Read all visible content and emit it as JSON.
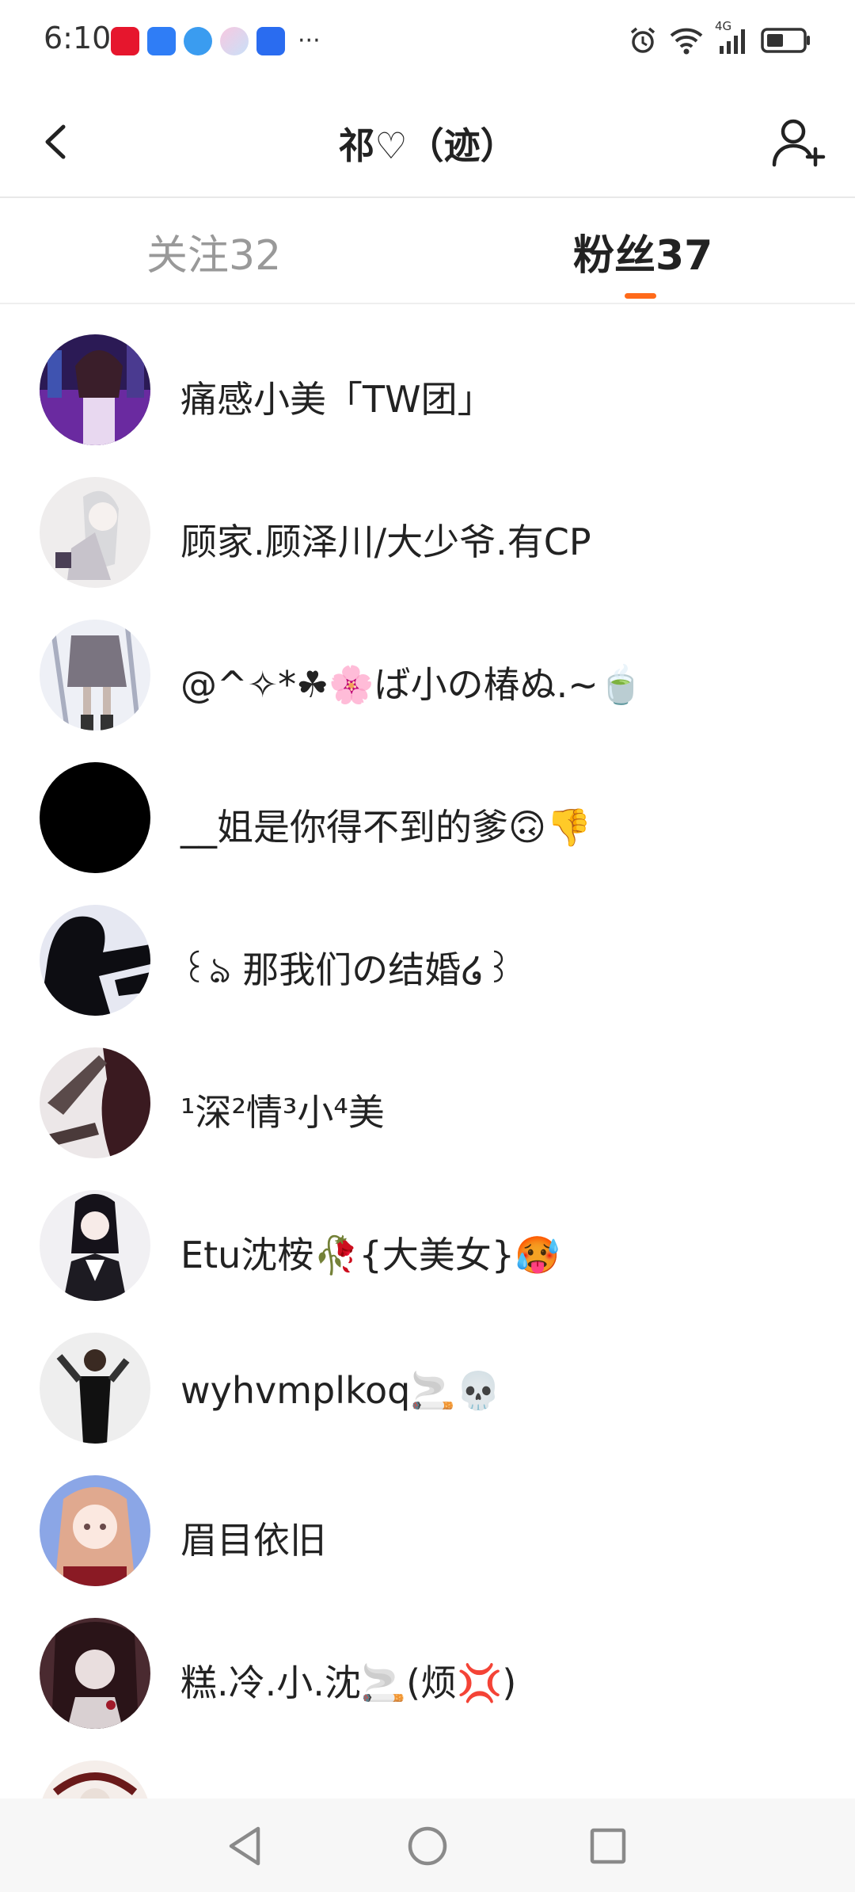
{
  "status_bar": {
    "time": "6:10",
    "more_notifications": "···",
    "network_label": "4G",
    "notification_icons": [
      "weibo-icon",
      "lightbulb-icon",
      "browser-icon",
      "pastel-app-icon",
      "lightning-app-icon"
    ],
    "system_icons": [
      "alarm-icon",
      "wifi-icon",
      "signal-icon",
      "battery-icon"
    ]
  },
  "header": {
    "title": "祁♡（迹）",
    "back_icon": "back-chevron-icon",
    "add_icon": "add-user-icon"
  },
  "tabs": [
    {
      "label": "关注32",
      "active": false
    },
    {
      "label": "粉丝37",
      "active": true
    }
  ],
  "colors": {
    "accent": "#ff6a1a",
    "inactive_tab": "#999999",
    "text": "#222222",
    "divider": "#e8e8e8"
  },
  "fans": [
    {
      "name": "痛感小美「TW团」",
      "avatar": "avatar-anime-girl-city"
    },
    {
      "name": "顾家.顾泽川/大少爷.有CP",
      "avatar": "avatar-white-hair-boy"
    },
    {
      "name": "@^✧*☘🌸ば小の椿ぬ.~🍵",
      "avatar": "avatar-skirt-figure"
    },
    {
      "name": "__姐是你得不到的爹🙃👎",
      "avatar": "avatar-black"
    },
    {
      "name": "꒰ঌ 那我们の结婚໒꒱",
      "avatar": "avatar-silhouette-pair"
    },
    {
      "name": "¹深²情³小⁴美",
      "avatar": "avatar-hand-over-face"
    },
    {
      "name": "Etu沈桉🥀{大美女}🥵",
      "avatar": "avatar-sailor-girl"
    },
    {
      "name": "wyhvmplkoq🚬💀",
      "avatar": "avatar-dark-figure"
    },
    {
      "name": "眉目依旧",
      "avatar": "avatar-pink-hair-girl"
    },
    {
      "name": "糕.冷.小.沈🚬(烦💢)",
      "avatar": "avatar-dark-anime"
    },
    {
      "name": "",
      "avatar": "avatar-partial"
    }
  ],
  "nav": [
    "nav-back-icon",
    "nav-home-icon",
    "nav-recent-icon"
  ]
}
